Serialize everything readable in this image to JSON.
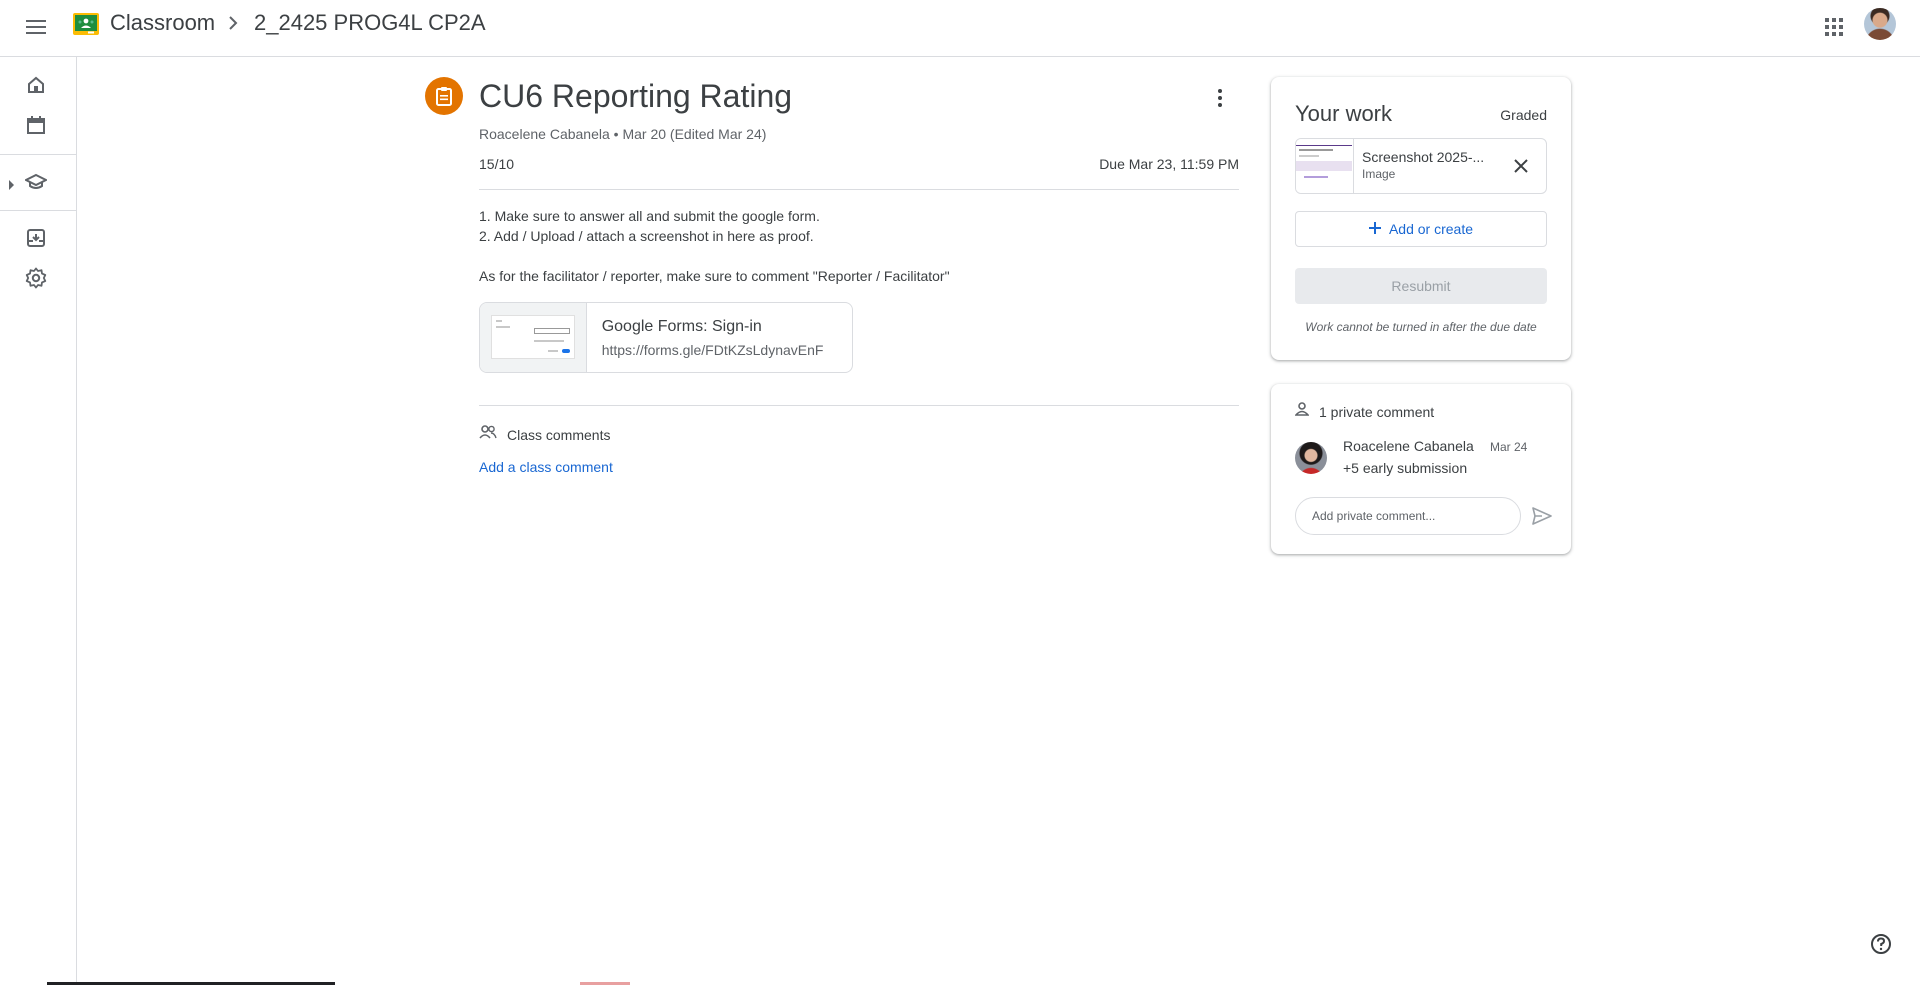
{
  "header": {
    "app_title": "Classroom",
    "class_name": "2_2425 PROG4L CP2A"
  },
  "assignment": {
    "title": "CU6 Reporting Rating",
    "author": "Roacelene Cabanela",
    "meta_separator": "•",
    "posted": "Mar 20 (Edited Mar 24)",
    "points": "15/10",
    "due": "Due Mar 23, 11:59 PM",
    "description": [
      "1. Make sure to answer all and submit the google form.",
      "2. Add / Upload / attach a screenshot in here as proof.",
      "As for the facilitator / reporter, make sure to comment \"Reporter / Facilitator\""
    ],
    "attachment": {
      "title": "Google Forms: Sign-in",
      "url": "https://forms.gle/FDtKZsLdynavEnF"
    },
    "class_comments_label": "Class comments",
    "add_class_comment": "Add a class comment"
  },
  "your_work": {
    "title": "Your work",
    "status": "Graded",
    "file": {
      "name": "Screenshot 2025-...",
      "type": "Image"
    },
    "add_or_create": "Add or create",
    "resubmit": "Resubmit",
    "note": "Work cannot be turned in after the due date"
  },
  "private_comments": {
    "header": "1 private comment",
    "comments": [
      {
        "author": "Roacelene Cabanela",
        "date": "Mar 24",
        "text": "+5 early submission"
      }
    ],
    "input_placeholder": "Add private comment..."
  },
  "icons": {
    "menu": "menu-icon",
    "apps": "apps-grid-icon",
    "home": "home-icon",
    "calendar": "calendar-icon",
    "enrolled": "school-cap-icon",
    "archive": "archive-icon",
    "settings": "gear-icon",
    "assignment": "assignment-icon",
    "more": "more-vert-icon",
    "people": "people-icon",
    "person": "person-icon",
    "send": "send-icon",
    "close": "close-icon",
    "plus": "plus-icon",
    "help": "help-icon"
  },
  "colors": {
    "accent_blue": "#1967d2",
    "assignment_orange": "#e37400",
    "classroom_green": "#1e8e3e",
    "classroom_yellow": "#fbbc04"
  }
}
